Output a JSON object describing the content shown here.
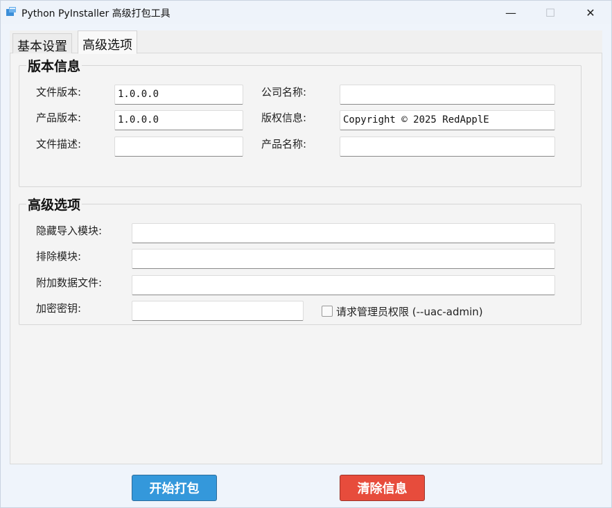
{
  "window": {
    "title": "Python PyInstaller 高级打包工具",
    "controls": {
      "minimize": "—",
      "maximize": "☐",
      "close": "✕"
    }
  },
  "tabs": [
    {
      "label": "基本设置",
      "active": false
    },
    {
      "label": "高级选项",
      "active": true
    }
  ],
  "version_info": {
    "title": "版本信息",
    "file_version_label": "文件版本:",
    "file_version_value": "1.0.0.0",
    "product_version_label": "产品版本:",
    "product_version_value": "1.0.0.0",
    "file_desc_label": "文件描述:",
    "file_desc_value": "",
    "company_label": "公司名称:",
    "company_value": "",
    "copyright_label": "版权信息:",
    "copyright_value": "Copyright © 2025 RedApplE",
    "product_name_label": "产品名称:",
    "product_name_value": ""
  },
  "advanced": {
    "title": "高级选项",
    "hidden_imports_label": "隐藏导入模块:",
    "hidden_imports_value": "",
    "exclude_label": "排除模块:",
    "exclude_value": "",
    "add_data_label": "附加数据文件:",
    "add_data_value": "",
    "key_label": "加密密钥:",
    "key_value": "",
    "uac_label": "请求管理员权限 (--uac-admin)",
    "uac_checked": false
  },
  "buttons": {
    "start": "开始打包",
    "clear": "清除信息"
  },
  "colors": {
    "start_button": "#3498db",
    "clear_button": "#e74c3c"
  }
}
